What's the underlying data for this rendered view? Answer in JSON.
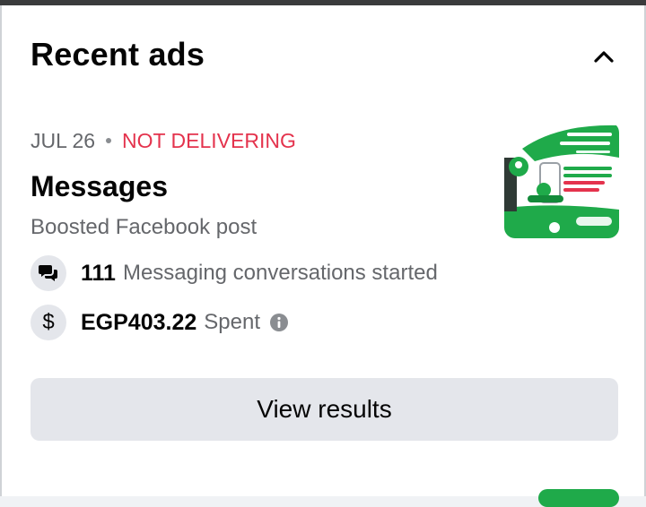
{
  "section": {
    "title": "Recent ads"
  },
  "ad": {
    "date": "JUL 26",
    "status": "NOT DELIVERING",
    "title": "Messages",
    "type": "Boosted Facebook post",
    "stats": [
      {
        "value": "111",
        "label": "Messaging conversations started",
        "icon": "chat-bubbles-icon"
      },
      {
        "value": "EGP403.22",
        "label": "Spent",
        "icon": "dollar-icon"
      }
    ]
  },
  "actions": {
    "view_results": "View results"
  },
  "colors": {
    "status_red": "#e4334d",
    "brand_green": "#1faa4a",
    "button_gray": "#e4e6eb"
  }
}
